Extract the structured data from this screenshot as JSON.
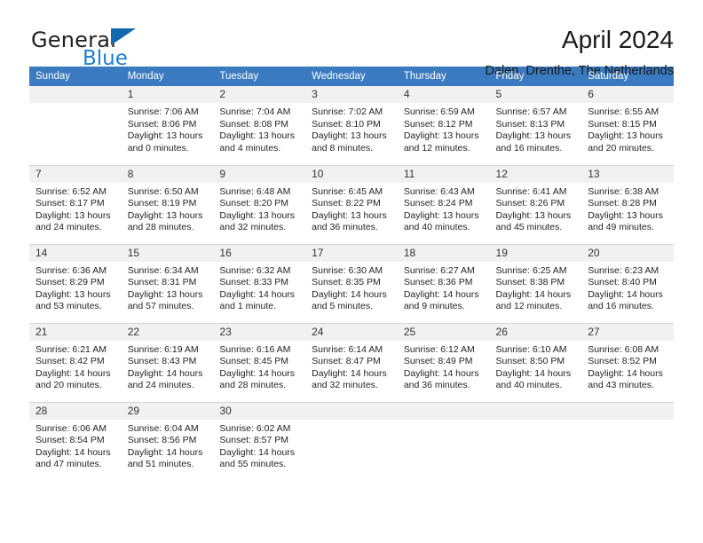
{
  "brand": {
    "name_primary": "General",
    "name_secondary": "Blue",
    "triangle_color": "#1269b0",
    "blue_color": "#1b7fd4"
  },
  "header": {
    "title": "April 2024",
    "subtitle": "Dalen, Drenthe, The Netherlands"
  },
  "theme": {
    "header_bg": "#3a7ac0",
    "header_text": "#ffffff",
    "daynum_bg": "#f1f1f1",
    "row_divider": "#d5d5d5"
  },
  "columns": [
    "Sunday",
    "Monday",
    "Tuesday",
    "Wednesday",
    "Thursday",
    "Friday",
    "Saturday"
  ],
  "weeks": [
    [
      {
        "day": "",
        "empty": true,
        "sunrise": "",
        "sunset": "",
        "daylight1": "",
        "daylight2": ""
      },
      {
        "day": "1",
        "empty": false,
        "sunrise": "Sunrise: 7:06 AM",
        "sunset": "Sunset: 8:06 PM",
        "daylight1": "Daylight: 13 hours",
        "daylight2": "and 0 minutes."
      },
      {
        "day": "2",
        "empty": false,
        "sunrise": "Sunrise: 7:04 AM",
        "sunset": "Sunset: 8:08 PM",
        "daylight1": "Daylight: 13 hours",
        "daylight2": "and 4 minutes."
      },
      {
        "day": "3",
        "empty": false,
        "sunrise": "Sunrise: 7:02 AM",
        "sunset": "Sunset: 8:10 PM",
        "daylight1": "Daylight: 13 hours",
        "daylight2": "and 8 minutes."
      },
      {
        "day": "4",
        "empty": false,
        "sunrise": "Sunrise: 6:59 AM",
        "sunset": "Sunset: 8:12 PM",
        "daylight1": "Daylight: 13 hours",
        "daylight2": "and 12 minutes."
      },
      {
        "day": "5",
        "empty": false,
        "sunrise": "Sunrise: 6:57 AM",
        "sunset": "Sunset: 8:13 PM",
        "daylight1": "Daylight: 13 hours",
        "daylight2": "and 16 minutes."
      },
      {
        "day": "6",
        "empty": false,
        "sunrise": "Sunrise: 6:55 AM",
        "sunset": "Sunset: 8:15 PM",
        "daylight1": "Daylight: 13 hours",
        "daylight2": "and 20 minutes."
      }
    ],
    [
      {
        "day": "7",
        "empty": false,
        "sunrise": "Sunrise: 6:52 AM",
        "sunset": "Sunset: 8:17 PM",
        "daylight1": "Daylight: 13 hours",
        "daylight2": "and 24 minutes."
      },
      {
        "day": "8",
        "empty": false,
        "sunrise": "Sunrise: 6:50 AM",
        "sunset": "Sunset: 8:19 PM",
        "daylight1": "Daylight: 13 hours",
        "daylight2": "and 28 minutes."
      },
      {
        "day": "9",
        "empty": false,
        "sunrise": "Sunrise: 6:48 AM",
        "sunset": "Sunset: 8:20 PM",
        "daylight1": "Daylight: 13 hours",
        "daylight2": "and 32 minutes."
      },
      {
        "day": "10",
        "empty": false,
        "sunrise": "Sunrise: 6:45 AM",
        "sunset": "Sunset: 8:22 PM",
        "daylight1": "Daylight: 13 hours",
        "daylight2": "and 36 minutes."
      },
      {
        "day": "11",
        "empty": false,
        "sunrise": "Sunrise: 6:43 AM",
        "sunset": "Sunset: 8:24 PM",
        "daylight1": "Daylight: 13 hours",
        "daylight2": "and 40 minutes."
      },
      {
        "day": "12",
        "empty": false,
        "sunrise": "Sunrise: 6:41 AM",
        "sunset": "Sunset: 8:26 PM",
        "daylight1": "Daylight: 13 hours",
        "daylight2": "and 45 minutes."
      },
      {
        "day": "13",
        "empty": false,
        "sunrise": "Sunrise: 6:38 AM",
        "sunset": "Sunset: 8:28 PM",
        "daylight1": "Daylight: 13 hours",
        "daylight2": "and 49 minutes."
      }
    ],
    [
      {
        "day": "14",
        "empty": false,
        "sunrise": "Sunrise: 6:36 AM",
        "sunset": "Sunset: 8:29 PM",
        "daylight1": "Daylight: 13 hours",
        "daylight2": "and 53 minutes."
      },
      {
        "day": "15",
        "empty": false,
        "sunrise": "Sunrise: 6:34 AM",
        "sunset": "Sunset: 8:31 PM",
        "daylight1": "Daylight: 13 hours",
        "daylight2": "and 57 minutes."
      },
      {
        "day": "16",
        "empty": false,
        "sunrise": "Sunrise: 6:32 AM",
        "sunset": "Sunset: 8:33 PM",
        "daylight1": "Daylight: 14 hours",
        "daylight2": "and 1 minute."
      },
      {
        "day": "17",
        "empty": false,
        "sunrise": "Sunrise: 6:30 AM",
        "sunset": "Sunset: 8:35 PM",
        "daylight1": "Daylight: 14 hours",
        "daylight2": "and 5 minutes."
      },
      {
        "day": "18",
        "empty": false,
        "sunrise": "Sunrise: 6:27 AM",
        "sunset": "Sunset: 8:36 PM",
        "daylight1": "Daylight: 14 hours",
        "daylight2": "and 9 minutes."
      },
      {
        "day": "19",
        "empty": false,
        "sunrise": "Sunrise: 6:25 AM",
        "sunset": "Sunset: 8:38 PM",
        "daylight1": "Daylight: 14 hours",
        "daylight2": "and 12 minutes."
      },
      {
        "day": "20",
        "empty": false,
        "sunrise": "Sunrise: 6:23 AM",
        "sunset": "Sunset: 8:40 PM",
        "daylight1": "Daylight: 14 hours",
        "daylight2": "and 16 minutes."
      }
    ],
    [
      {
        "day": "21",
        "empty": false,
        "sunrise": "Sunrise: 6:21 AM",
        "sunset": "Sunset: 8:42 PM",
        "daylight1": "Daylight: 14 hours",
        "daylight2": "and 20 minutes."
      },
      {
        "day": "22",
        "empty": false,
        "sunrise": "Sunrise: 6:19 AM",
        "sunset": "Sunset: 8:43 PM",
        "daylight1": "Daylight: 14 hours",
        "daylight2": "and 24 minutes."
      },
      {
        "day": "23",
        "empty": false,
        "sunrise": "Sunrise: 6:16 AM",
        "sunset": "Sunset: 8:45 PM",
        "daylight1": "Daylight: 14 hours",
        "daylight2": "and 28 minutes."
      },
      {
        "day": "24",
        "empty": false,
        "sunrise": "Sunrise: 6:14 AM",
        "sunset": "Sunset: 8:47 PM",
        "daylight1": "Daylight: 14 hours",
        "daylight2": "and 32 minutes."
      },
      {
        "day": "25",
        "empty": false,
        "sunrise": "Sunrise: 6:12 AM",
        "sunset": "Sunset: 8:49 PM",
        "daylight1": "Daylight: 14 hours",
        "daylight2": "and 36 minutes."
      },
      {
        "day": "26",
        "empty": false,
        "sunrise": "Sunrise: 6:10 AM",
        "sunset": "Sunset: 8:50 PM",
        "daylight1": "Daylight: 14 hours",
        "daylight2": "and 40 minutes."
      },
      {
        "day": "27",
        "empty": false,
        "sunrise": "Sunrise: 6:08 AM",
        "sunset": "Sunset: 8:52 PM",
        "daylight1": "Daylight: 14 hours",
        "daylight2": "and 43 minutes."
      }
    ],
    [
      {
        "day": "28",
        "empty": false,
        "sunrise": "Sunrise: 6:06 AM",
        "sunset": "Sunset: 8:54 PM",
        "daylight1": "Daylight: 14 hours",
        "daylight2": "and 47 minutes."
      },
      {
        "day": "29",
        "empty": false,
        "sunrise": "Sunrise: 6:04 AM",
        "sunset": "Sunset: 8:56 PM",
        "daylight1": "Daylight: 14 hours",
        "daylight2": "and 51 minutes."
      },
      {
        "day": "30",
        "empty": false,
        "sunrise": "Sunrise: 6:02 AM",
        "sunset": "Sunset: 8:57 PM",
        "daylight1": "Daylight: 14 hours",
        "daylight2": "and 55 minutes."
      },
      {
        "day": "",
        "empty": true,
        "sunrise": "",
        "sunset": "",
        "daylight1": "",
        "daylight2": ""
      },
      {
        "day": "",
        "empty": true,
        "sunrise": "",
        "sunset": "",
        "daylight1": "",
        "daylight2": ""
      },
      {
        "day": "",
        "empty": true,
        "sunrise": "",
        "sunset": "",
        "daylight1": "",
        "daylight2": ""
      },
      {
        "day": "",
        "empty": true,
        "sunrise": "",
        "sunset": "",
        "daylight1": "",
        "daylight2": ""
      }
    ]
  ]
}
